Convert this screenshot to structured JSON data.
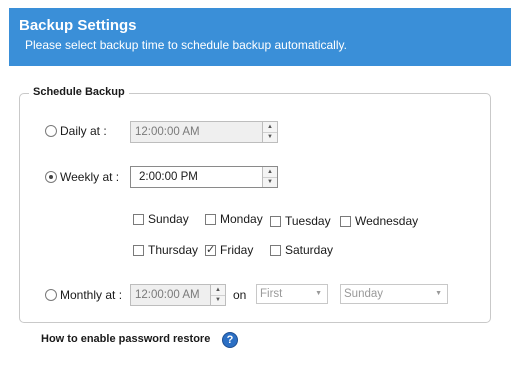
{
  "header": {
    "title": "Backup Settings",
    "subtitle": "Please select backup time to schedule backup automatically."
  },
  "schedule": {
    "legend": "Schedule Backup",
    "daily": {
      "label": "Daily at :",
      "time": "12:00:00 AM",
      "selected": false
    },
    "weekly": {
      "label": "Weekly at :",
      "time": "2:00:00 PM",
      "selected": true
    },
    "days": [
      {
        "label": "Sunday",
        "checked": false
      },
      {
        "label": "Monday",
        "checked": false
      },
      {
        "label": "Tuesday",
        "checked": false
      },
      {
        "label": "Wednesday",
        "checked": false
      },
      {
        "label": "Thursday",
        "checked": false
      },
      {
        "label": "Friday",
        "checked": true
      },
      {
        "label": "Saturday",
        "checked": false
      }
    ],
    "monthly": {
      "label": "Monthly at :",
      "time": "12:00:00 AM",
      "selected": false,
      "on_label": "on",
      "occurrence": "First",
      "weekday": "Sunday"
    }
  },
  "help": {
    "text": "How to enable password restore",
    "icon": "help-icon"
  },
  "colors": {
    "header_bg": "#3a8fd8"
  }
}
